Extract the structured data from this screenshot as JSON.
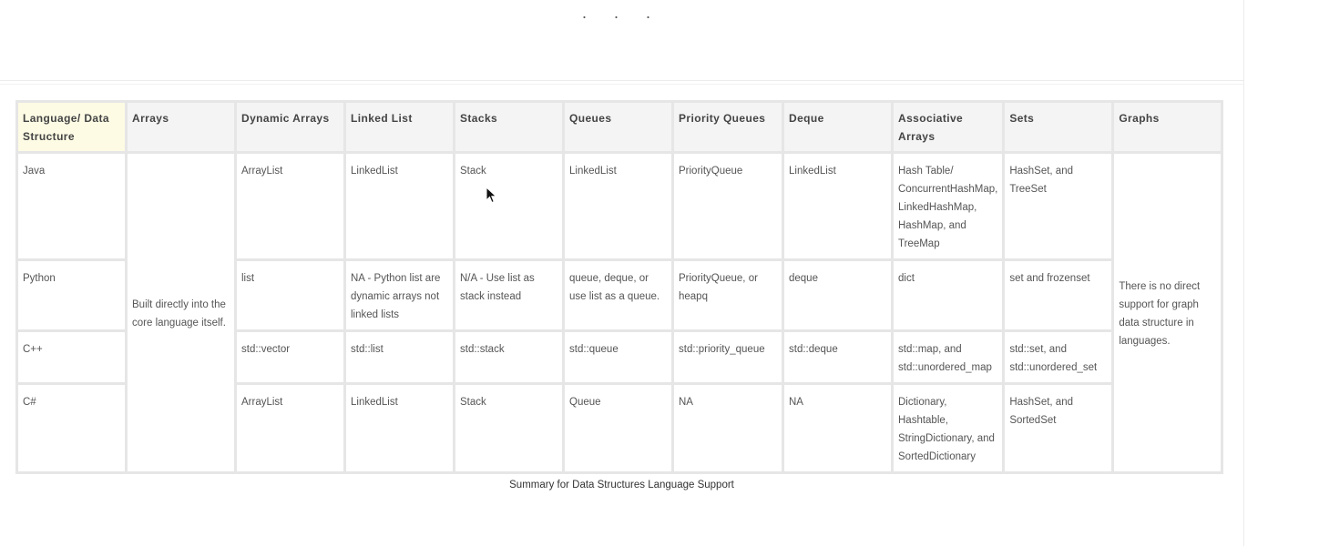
{
  "top_indicator": "· · ·",
  "table": {
    "headers": [
      "Language/ Data Structure",
      "Arrays",
      "Dynamic Arrays",
      "Linked List",
      "Stacks",
      "Queues",
      "Priority Queues",
      "Deque",
      "Associative Arrays",
      "Sets",
      "Graphs"
    ],
    "arrays_cell": "Built directly into the core language itself.",
    "graphs_cell": "There is no direct support for graph data structure in languages.",
    "rows": [
      {
        "lang": "Java",
        "dynamic": "ArrayList",
        "linked": "LinkedList",
        "stacks": "Stack",
        "queues": "LinkedList",
        "pq": "PriorityQueue",
        "deque": "LinkedList",
        "assoc": "Hash Table/ ConcurrentHashMap, LinkedHashMap, HashMap, and TreeMap",
        "sets": "HashSet, and TreeSet"
      },
      {
        "lang": "Python",
        "dynamic": "list",
        "linked": "NA - Python list are dynamic arrays not linked lists",
        "stacks": "N/A - Use list as stack instead",
        "queues": "queue, deque, or use list as a queue.",
        "pq": "PriorityQueue, or heapq",
        "deque": "deque",
        "assoc": "dict",
        "sets": "set and frozenset"
      },
      {
        "lang": "C++",
        "dynamic": "std::vector",
        "linked": "std::list",
        "stacks": "std::stack",
        "queues": "std::queue",
        "pq": "std::priority_queue",
        "deque": "std::deque",
        "assoc": "std::map, and std::unordered_map",
        "sets": "std::set, and std::unordered_set"
      },
      {
        "lang": "C#",
        "dynamic": "ArrayList",
        "linked": "LinkedList",
        "stacks": "Stack",
        "queues": "Queue",
        "pq": "NA",
        "deque": "NA",
        "assoc": "Dictionary, Hashtable, StringDictionary, and SortedDictionary",
        "sets": "HashSet, and SortedSet"
      }
    ]
  },
  "caption": "Summary for Data Structures Language Support"
}
